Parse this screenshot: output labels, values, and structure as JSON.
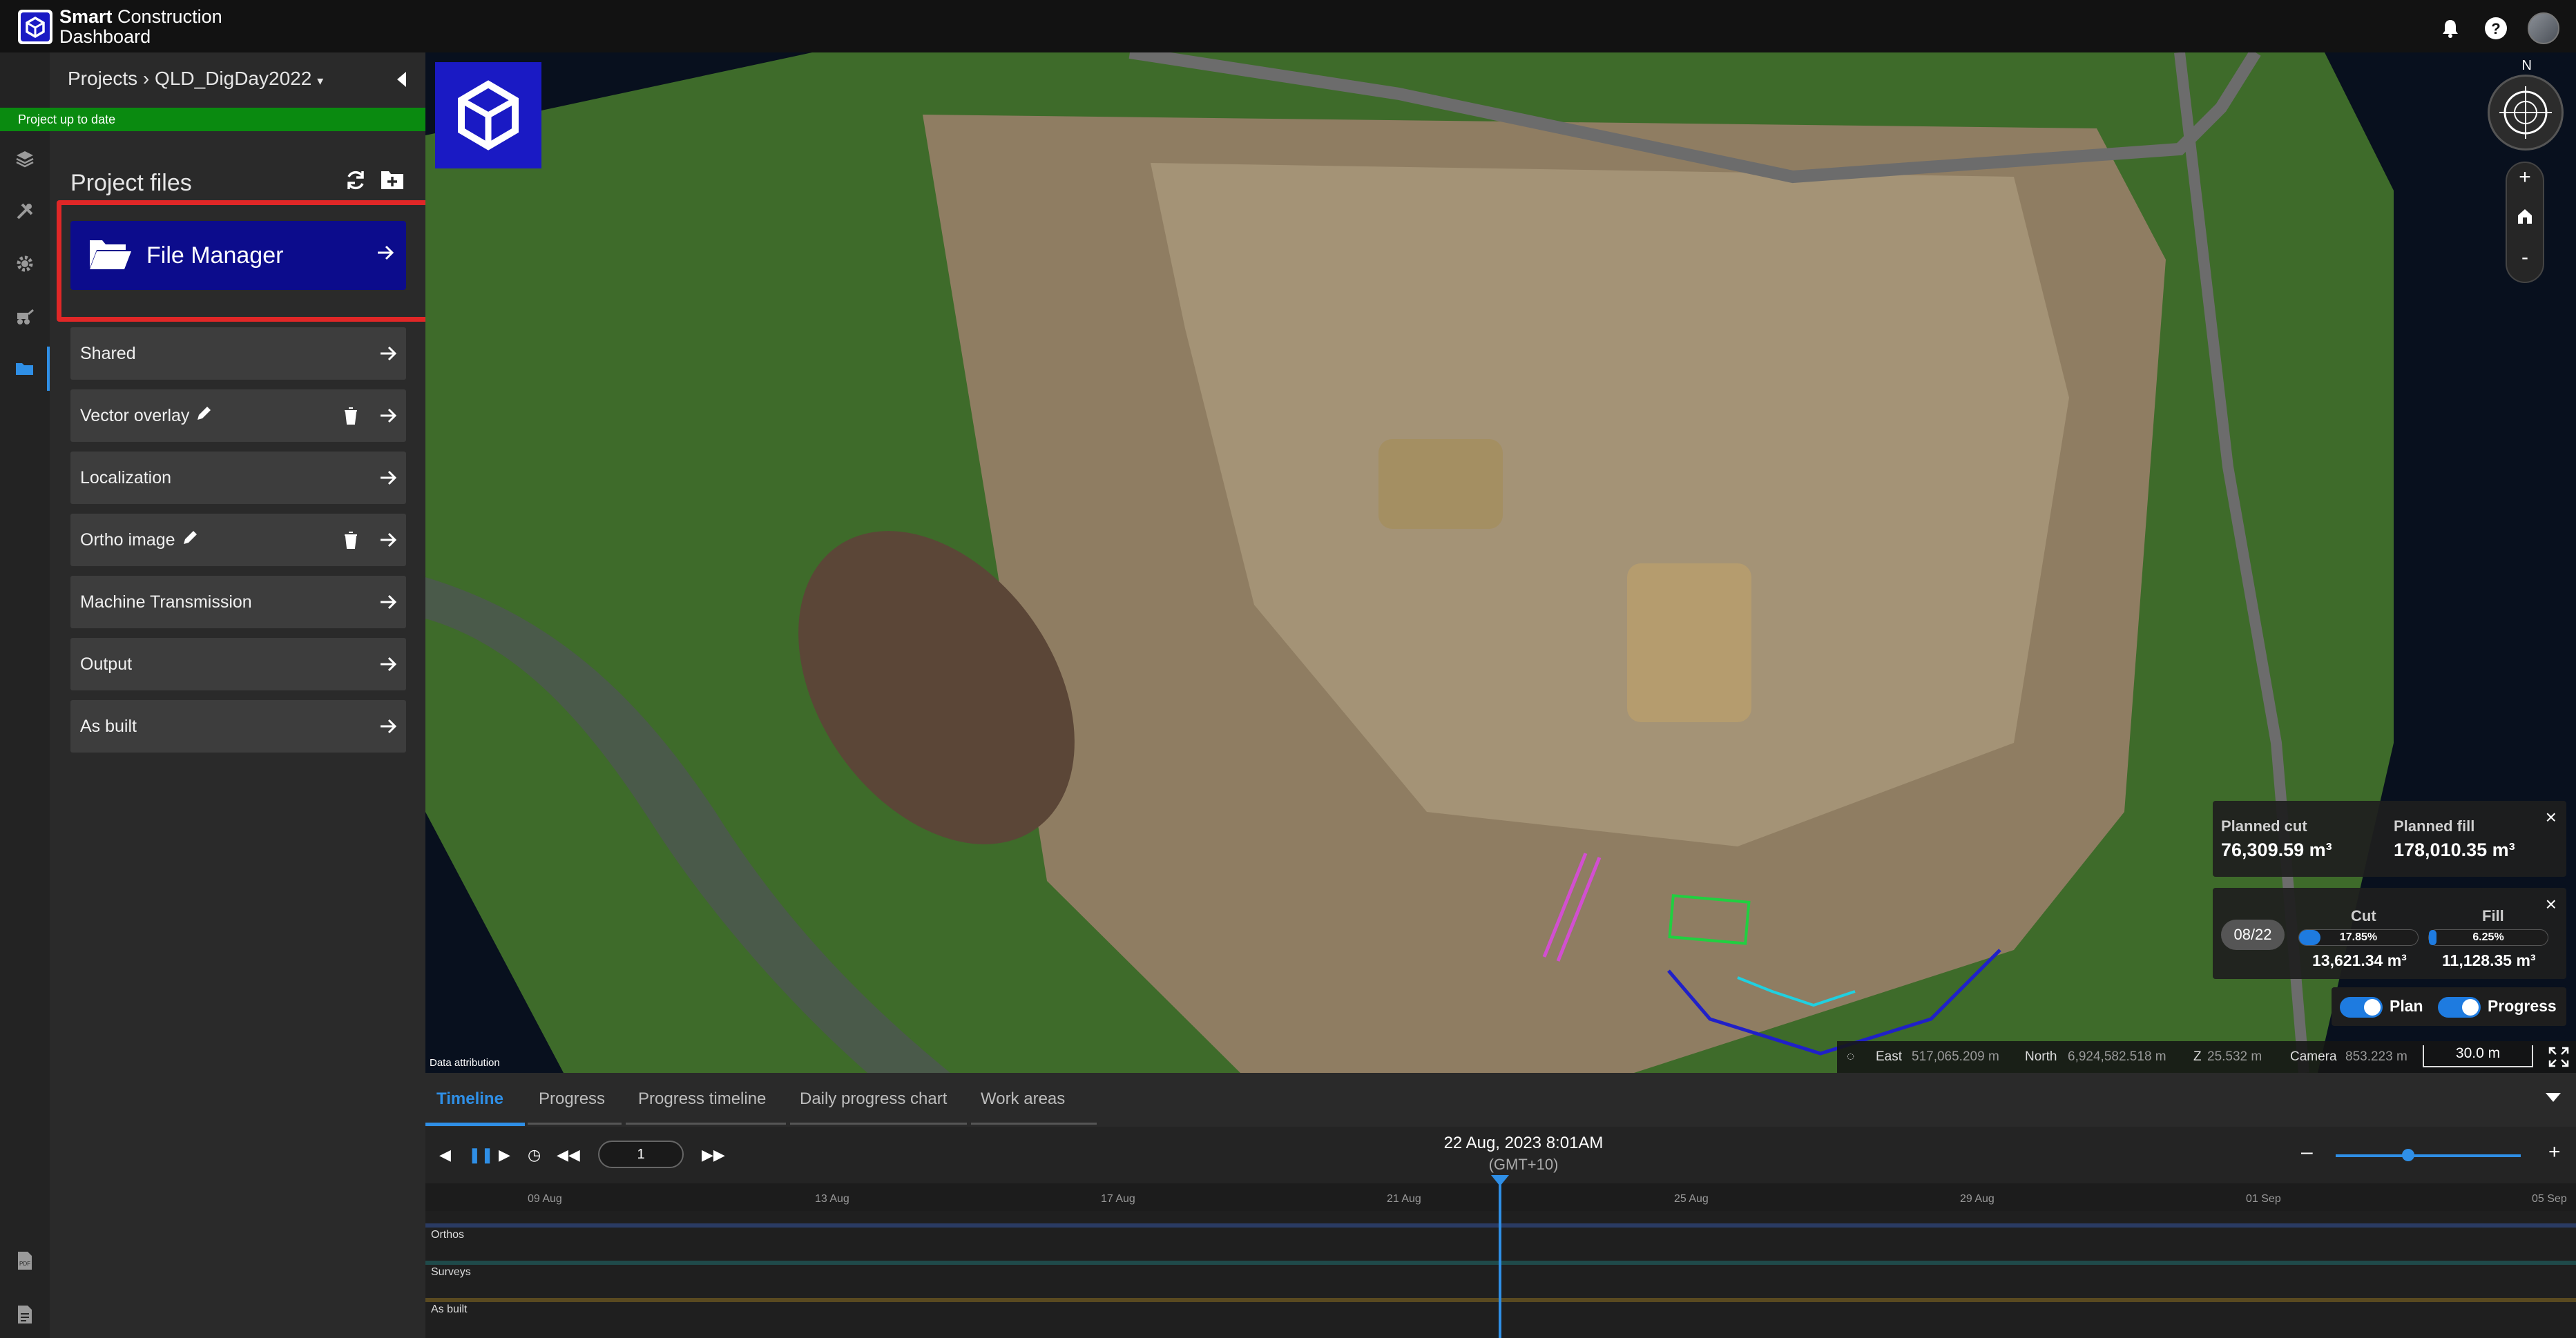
{
  "app": {
    "brand_line1_bold": "Smart",
    "brand_line1": " Construction",
    "brand_line2": "Dashboard",
    "icons": [
      "bell-icon",
      "help-icon",
      "user-avatar"
    ]
  },
  "sidebar": {
    "breadcrumb_root": "Projects",
    "breadcrumb_sep": " › ",
    "project_name": "QLD_DigDay2022",
    "status_text": "Project up to date",
    "section_title": "Project files",
    "file_manager_label": "File Manager",
    "items": [
      {
        "label": "Shared",
        "editable": false,
        "deletable": false
      },
      {
        "label": "Vector overlay",
        "editable": true,
        "deletable": true
      },
      {
        "label": "Localization",
        "editable": false,
        "deletable": false
      },
      {
        "label": "Ortho image",
        "editable": true,
        "deletable": true
      },
      {
        "label": "Machine Transmission",
        "editable": false,
        "deletable": false
      },
      {
        "label": "Output",
        "editable": false,
        "deletable": false
      },
      {
        "label": "As built",
        "editable": false,
        "deletable": false
      }
    ],
    "rail_icons": [
      "layers-icon",
      "tools-icon",
      "settings-icon",
      "machine-icon",
      "folder-icon",
      "pdf-icon",
      "report-icon"
    ]
  },
  "map": {
    "attribution": "Data attribution",
    "compass_label": "N",
    "zoom_in": "+",
    "zoom_out": "-",
    "planned": {
      "cut_label": "Planned cut",
      "cut_value": "76,309.59 m³",
      "fill_label": "Planned fill",
      "fill_value": "178,010.35 m³"
    },
    "progress": {
      "date": "08/22",
      "cut_label": "Cut",
      "cut_pct": "17.85%",
      "cut_fraction": 0.1785,
      "cut_value": "13,621.34 m³",
      "fill_label": "Fill",
      "fill_pct": "6.25%",
      "fill_fraction": 0.0625,
      "fill_value": "11,128.35 m³"
    },
    "toggles": {
      "plan": "Plan",
      "progress": "Progress"
    },
    "coords": {
      "east_label": "East",
      "east_value": "517,065.209 m",
      "north_label": "North",
      "north_value": "6,924,582.518 m",
      "z_label": "Z",
      "z_value": "25.532 m",
      "camera_label": "Camera",
      "camera_value": "853.223 m",
      "scale": "30.0 m"
    }
  },
  "timeline": {
    "tabs": [
      "Timeline",
      "Progress",
      "Progress timeline",
      "Daily progress chart",
      "Work areas"
    ],
    "active_tab": "Timeline",
    "frame": "1",
    "current_date": "22 Aug, 2023 8:01AM",
    "timezone": "(GMT+10)",
    "ticks": [
      "09 Aug",
      "13 Aug",
      "17 Aug",
      "21 Aug",
      "25 Aug",
      "29 Aug",
      "01 Sep",
      "05 Sep"
    ],
    "rows": [
      {
        "name": "Orthos",
        "color": "#2a3b63"
      },
      {
        "name": "Surveys",
        "color": "#1f4a4a"
      },
      {
        "name": "As built",
        "color": "#5a4a20"
      }
    ],
    "zoom_minus": "–",
    "zoom_plus": "+"
  },
  "colors": {
    "accent": "#2f8fe6",
    "file_manager_bg": "#0c0c8c",
    "highlight": "#e02727",
    "status_green": "#0a8a10"
  }
}
